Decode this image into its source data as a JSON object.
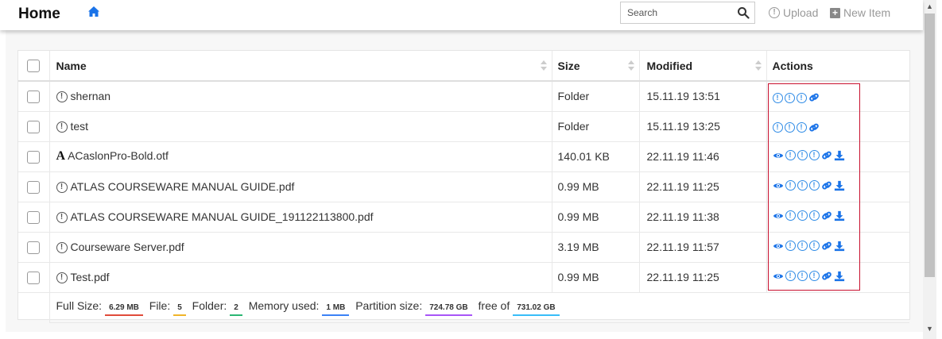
{
  "header": {
    "title": "Home",
    "search_placeholder": "Search",
    "upload_label": "Upload",
    "new_item_label": "New Item"
  },
  "table": {
    "columns": [
      "Name",
      "Size",
      "Modified",
      "Actions"
    ],
    "rows": [
      {
        "name": "shernan",
        "size": "Folder",
        "modified": "15.11.19 13:51",
        "icon": "exclamation-circle-icon",
        "type": "folder"
      },
      {
        "name": "test",
        "size": "Folder",
        "modified": "15.11.19 13:25",
        "icon": "exclamation-circle-icon",
        "type": "folder"
      },
      {
        "name": "ACaslonPro-Bold.otf",
        "size": "140.01 KB",
        "modified": "22.11.19 11:46",
        "icon": "font-icon",
        "type": "file"
      },
      {
        "name": "ATLAS COURSEWARE MANUAL GUIDE.pdf",
        "size": "0.99 MB",
        "modified": "22.11.19 11:25",
        "icon": "exclamation-circle-icon",
        "type": "file"
      },
      {
        "name": "ATLAS COURSEWARE MANUAL GUIDE_191122113800.pdf",
        "size": "0.99 MB",
        "modified": "22.11.19 11:38",
        "icon": "exclamation-circle-icon",
        "type": "file"
      },
      {
        "name": "Courseware Server.pdf",
        "size": "3.19 MB",
        "modified": "22.11.19 11:57",
        "icon": "exclamation-circle-icon",
        "type": "file"
      },
      {
        "name": "Test.pdf",
        "size": "0.99 MB",
        "modified": "22.11.19 11:25",
        "icon": "exclamation-circle-icon",
        "type": "file"
      }
    ]
  },
  "footer": {
    "full_size_label": "Full Size:",
    "full_size_value": "6.29 MB",
    "file_label": "File:",
    "file_value": "5",
    "folder_label": "Folder:",
    "folder_value": "2",
    "memory_label": "Memory used:",
    "memory_value": "1 MB",
    "partition_label": "Partition size:",
    "partition_value": "724.78 GB",
    "free_label": "free of",
    "free_value": "731.02 GB"
  },
  "colors": {
    "accent": "#1a73e8",
    "highlight_border": "#c8102e",
    "full_size_underline": "#e04b3a",
    "file_underline": "#f0b429",
    "folder_underline": "#2bb673",
    "memory_underline": "#3b82f6",
    "partition_underline": "#a855f7",
    "free_underline": "#38bdf8"
  }
}
